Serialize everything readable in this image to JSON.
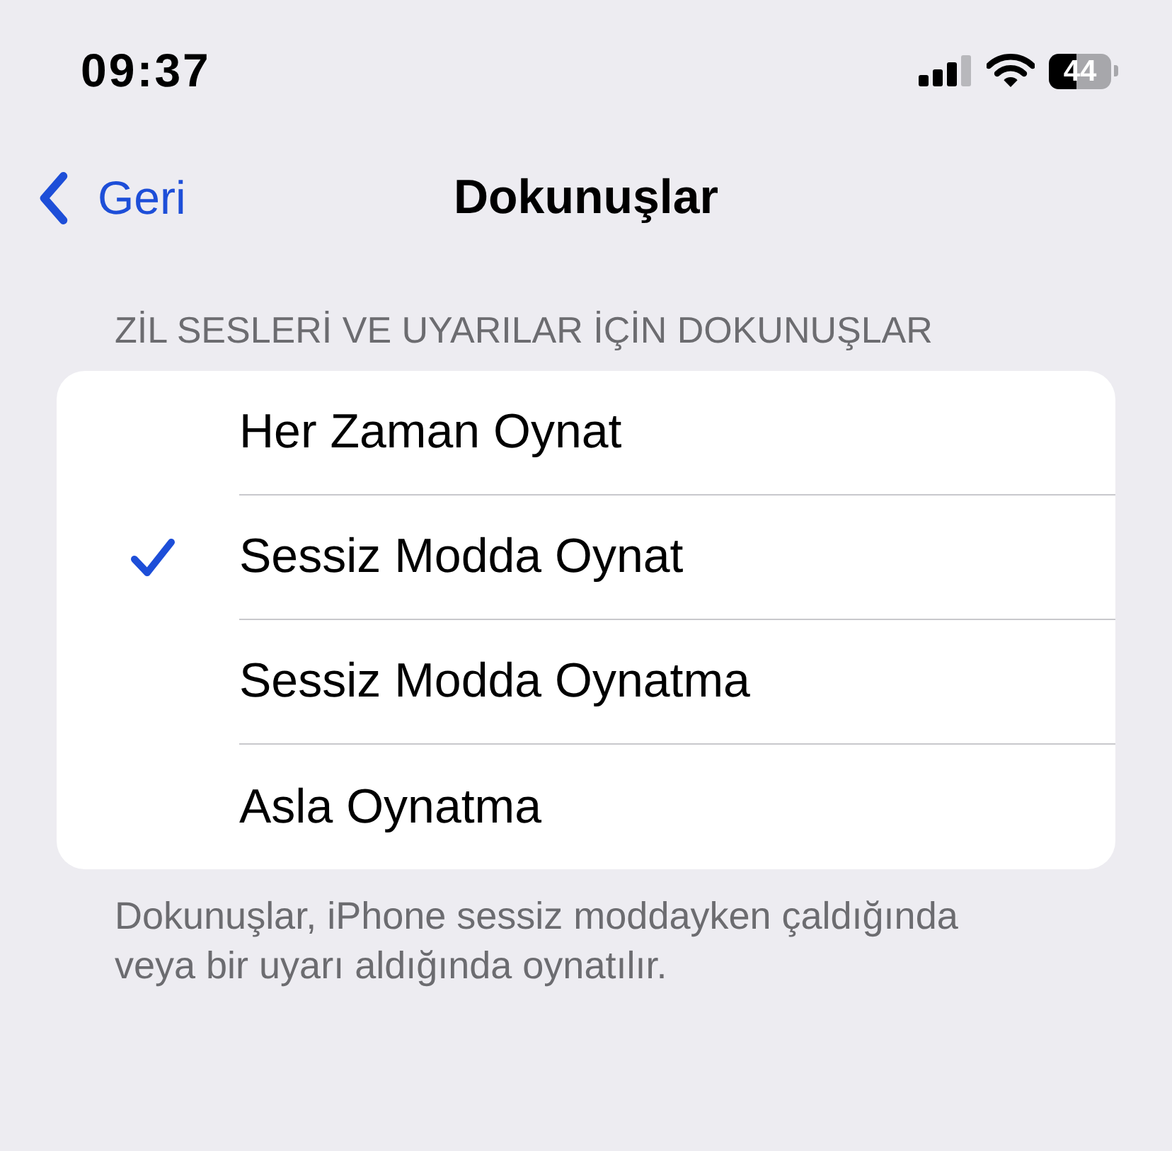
{
  "status_bar": {
    "time": "09:37",
    "battery": "44"
  },
  "nav": {
    "back": "Geri",
    "title": "Dokunuşlar"
  },
  "section": {
    "header": "ZİL SESLERİ VE UYARILAR İÇİN DOKUNUŞLAR",
    "options": [
      {
        "label": "Her Zaman Oynat",
        "selected": false
      },
      {
        "label": "Sessiz Modda Oynat",
        "selected": true
      },
      {
        "label": "Sessiz Modda Oynatma",
        "selected": false
      },
      {
        "label": "Asla Oynatma",
        "selected": false
      }
    ],
    "footer": "Dokunuşlar, iPhone sessiz moddayken çaldığında veya bir uyarı aldığında oynatılır."
  }
}
